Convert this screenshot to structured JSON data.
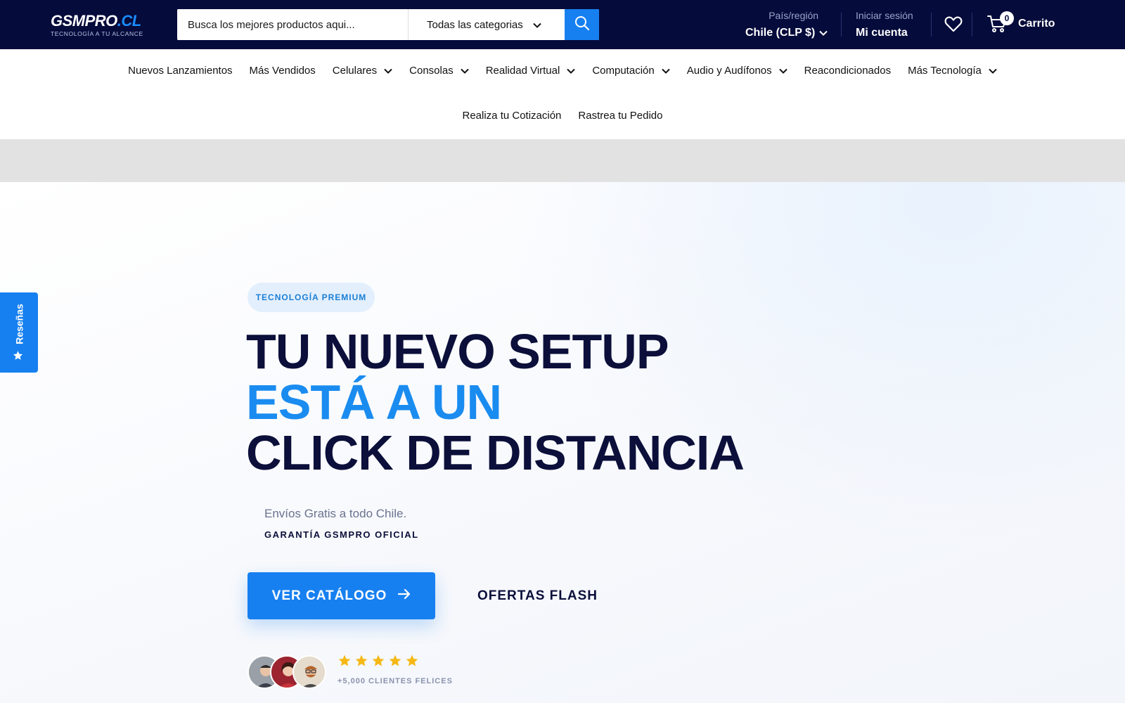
{
  "header": {
    "logo": {
      "brand": "GSMPRO",
      "tld": ".CL",
      "tagline": "TECNOLOGÍA A TU ALCANCE"
    },
    "search": {
      "placeholder": "Busca los mejores productos aqui...",
      "category": "Todas las categorias",
      "icon": "search-icon"
    },
    "region": {
      "label": "País/región",
      "value": "Chile (CLP $)"
    },
    "account": {
      "label": "Iniciar sesión",
      "value": "Mi cuenta"
    },
    "wishlist_icon": "heart-icon",
    "cart": {
      "count": "0",
      "label": "Carrito",
      "icon": "cart-icon"
    },
    "colors": {
      "bar": "#050b3b",
      "accent": "#1780f0"
    }
  },
  "nav": {
    "row1": [
      {
        "label": "Nuevos Lanzamientos",
        "dropdown": false
      },
      {
        "label": "Más Vendidos",
        "dropdown": false
      },
      {
        "label": "Celulares",
        "dropdown": true
      },
      {
        "label": "Consolas",
        "dropdown": true
      },
      {
        "label": "Realidad Virtual",
        "dropdown": true
      },
      {
        "label": "Computación",
        "dropdown": true
      },
      {
        "label": "Audio y Audífonos",
        "dropdown": true
      },
      {
        "label": "Reacondicionados",
        "dropdown": false
      },
      {
        "label": "Más Tecnología",
        "dropdown": true
      }
    ],
    "row2": [
      {
        "label": "Realiza tu Cotización",
        "dropdown": false
      },
      {
        "label": "Rastrea tu Pedido",
        "dropdown": false
      }
    ]
  },
  "hero": {
    "badge": "TECNOLOGÍA PREMIUM",
    "headline": {
      "line1": "TU NUEVO SETUP",
      "line2": "ESTÁ A UN",
      "line3": "CLICK DE DISTANCIA"
    },
    "subtitle": "Envíos Gratis a todo Chile.",
    "guarantee": "GARANTÍA GSMPRO OFICIAL",
    "primary_cta": "VER CATÁLOGO",
    "secondary_cta": "OFERTAS FLASH",
    "rating": {
      "stars": 5,
      "caption": "+5,000 CLIENTES FELICES"
    }
  },
  "reviews_tab": {
    "label": "Reseñas",
    "icon": "star-icon"
  }
}
